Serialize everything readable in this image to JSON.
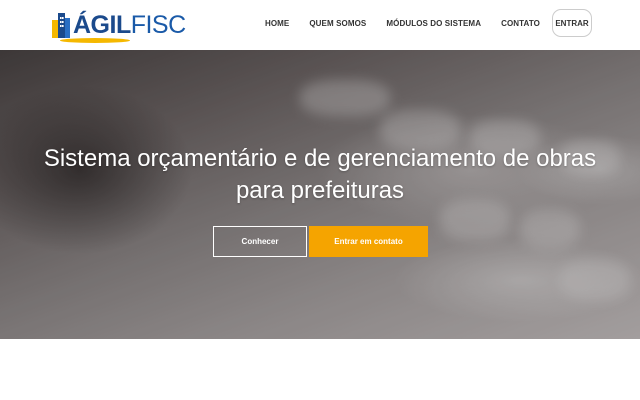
{
  "brand": {
    "name_part1": "ÁGIL",
    "name_part2": "FISC",
    "colors": {
      "primary": "#1b4a8c",
      "accent": "#f5b800"
    }
  },
  "nav": {
    "items": [
      {
        "label": "HOME"
      },
      {
        "label": "QUEM SOMOS"
      },
      {
        "label": "MÓDULOS DO SISTEMA"
      },
      {
        "label": "CONTATO"
      }
    ],
    "login_label": "ENTRAR"
  },
  "hero": {
    "title_line1": "Sistema orçamentário e de gerenciamento de obras",
    "title_line2": "para prefeituras",
    "secondary_button": "Conhecer",
    "primary_button": "Entrar em contato",
    "primary_button_color": "#f5a400"
  }
}
